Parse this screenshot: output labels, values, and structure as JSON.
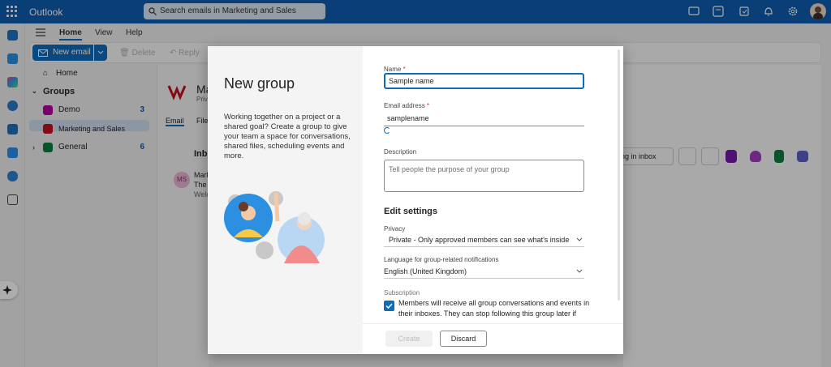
{
  "app": {
    "name": "Outlook"
  },
  "search": {
    "placeholder": "Search emails in Marketing and Sales"
  },
  "ribbon": {
    "tabs": [
      "Home",
      "View",
      "Help"
    ],
    "new_email": "New email",
    "delete": "Delete",
    "reply": "Reply"
  },
  "folders": {
    "home": "Home",
    "groups_header": "Groups",
    "items": [
      {
        "label": "Demo",
        "count": "3",
        "color": "#b4009e"
      },
      {
        "label": "Marketing and Sales",
        "count": "",
        "color": "#c50f1f"
      },
      {
        "label": "General",
        "count": "6",
        "color": "#107c41"
      }
    ]
  },
  "group_header": {
    "title": "Ma",
    "subtitle": "Priv",
    "tab_email": "Email",
    "tab_files": "Files"
  },
  "message_list": {
    "heading": "Inbo",
    "sender_initials": "MS",
    "line1": "Mark",
    "line2": "The",
    "line3": "Welc"
  },
  "right_panel": {
    "inbox_filter": "ing in inbox"
  },
  "dialog": {
    "title": "New group",
    "description": "Working together on a project or a shared goal? Create a group to give your team a space for conversations, shared files, scheduling events and more.",
    "name_label": "Name",
    "name_value": "Sample name",
    "email_label": "Email address",
    "email_value": "samplename",
    "description_label": "Description",
    "description_placeholder": "Tell people the purpose of your group",
    "edit_settings": "Edit settings",
    "privacy_label": "Privacy",
    "privacy_value": "Private - Only approved members can see what's inside",
    "language_label": "Language for group-related notifications",
    "language_value": "English (United Kingdom)",
    "subscription_label": "Subscription",
    "subscription_text": "Members will receive all group conversations and events in their inboxes. They can stop following this group later if",
    "create": "Create",
    "discard": "Discard"
  },
  "colors": {
    "brand": "#0f5cae",
    "accent": "#0f6cbd"
  }
}
